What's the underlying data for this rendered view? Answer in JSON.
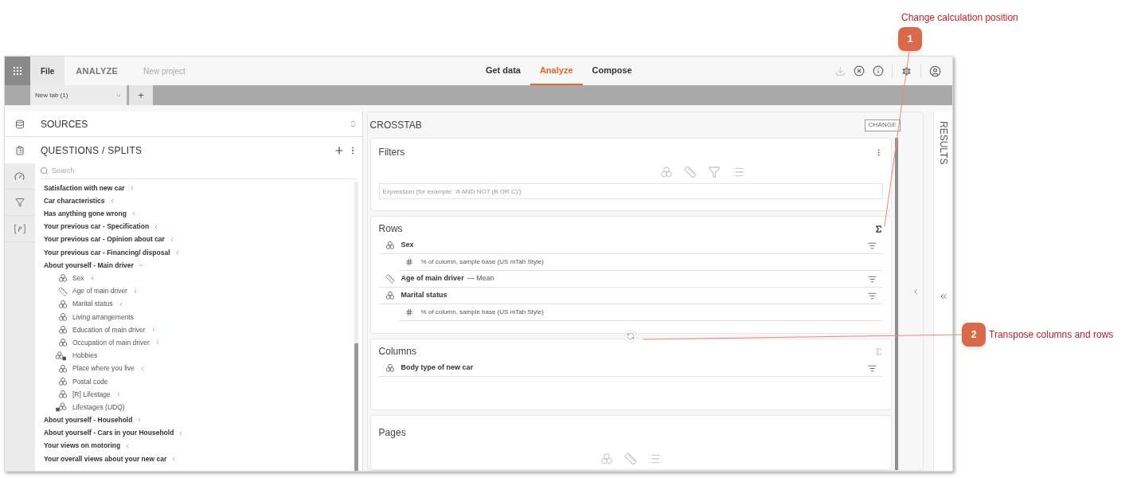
{
  "callouts": [
    {
      "number": "1",
      "text": "Change calculation position"
    },
    {
      "number": "2",
      "text": "Transpose columns and rows"
    }
  ],
  "top_bar": {
    "file_tab": "File",
    "module": "ANALYZE",
    "project": "New project",
    "nav_tabs": [
      {
        "label": "Get data",
        "selected": false
      },
      {
        "label": "Analyze",
        "selected": true
      },
      {
        "label": "Compose",
        "selected": false
      }
    ]
  },
  "tab_strip": {
    "tabs": [
      {
        "label": "New tab (1)"
      }
    ],
    "add_label": "+"
  },
  "sidebar": {
    "sources_title": "SOURCES",
    "questions_title": "QUESTIONS / SPLITS",
    "search": {
      "placeholder": "Search"
    },
    "items": [
      {
        "label": "Satisfaction with new car",
        "expanded": false
      },
      {
        "label": "Car characteristics",
        "expanded": false
      },
      {
        "label": "Has anything gone wrong",
        "expanded": false
      },
      {
        "label": "Your previous car - Specification",
        "expanded": false
      },
      {
        "label": "Your previous car - Opinion about car",
        "expanded": false
      },
      {
        "label": "Your previous car - Financing/ disposal",
        "expanded": false
      },
      {
        "label": "About yourself - Main driver",
        "expanded": true,
        "children": [
          {
            "label": "Sex",
            "kind": "categorical",
            "marked": true
          },
          {
            "label": "Age of main driver",
            "kind": "numeric",
            "marked": true
          },
          {
            "label": "Marital status",
            "kind": "categorical",
            "marked": true
          },
          {
            "label": "Living arrangements",
            "kind": "categorical",
            "marked": false
          },
          {
            "label": "Education of main driver",
            "kind": "categorical",
            "marked": true
          },
          {
            "label": "Occupation of main driver",
            "kind": "categorical",
            "marked": true
          },
          {
            "label": "Hobbies",
            "kind": "multi",
            "marked": false
          },
          {
            "label": "Place where you live",
            "kind": "categorical",
            "marked": true
          },
          {
            "label": "Postal code",
            "kind": "categorical",
            "marked": false
          },
          {
            "label": "[R] Lifestage",
            "kind": "categorical",
            "marked": true
          },
          {
            "label": "Lifestages (UDQ)",
            "kind": "derived",
            "marked": false
          }
        ]
      },
      {
        "label": "About yourself - Household",
        "expanded": false
      },
      {
        "label": "About yourself - Cars in your Household",
        "expanded": false
      },
      {
        "label": "Your views on motoring",
        "expanded": false
      },
      {
        "label": "Your overall views about your new car",
        "expanded": false
      }
    ]
  },
  "crosstab": {
    "title": "CROSSTAB",
    "change_button": "CHANGE",
    "filters": {
      "title": "Filters",
      "expression": {
        "placeholder": "Expression (for example: 'A AND NOT (B OR C)')"
      }
    },
    "rows": {
      "title": "Rows",
      "totals_on": true,
      "items": [
        {
          "name": "Sex",
          "kind": "categorical",
          "children": [
            {
              "label": "% of column, sample base (US mTab Style)"
            }
          ]
        },
        {
          "name": "Age of main driver",
          "kind": "numeric",
          "statistic": "— Mean"
        },
        {
          "name": "Marital status",
          "kind": "categorical",
          "children": [
            {
              "label": "% of column, sample base (US mTab Style)"
            }
          ]
        }
      ]
    },
    "columns": {
      "title": "Columns",
      "totals_on": false,
      "items": [
        {
          "name": "Body type of new car",
          "kind": "categorical"
        }
      ]
    },
    "pages": {
      "title": "Pages"
    }
  },
  "results": {
    "title": "RESULTS"
  }
}
